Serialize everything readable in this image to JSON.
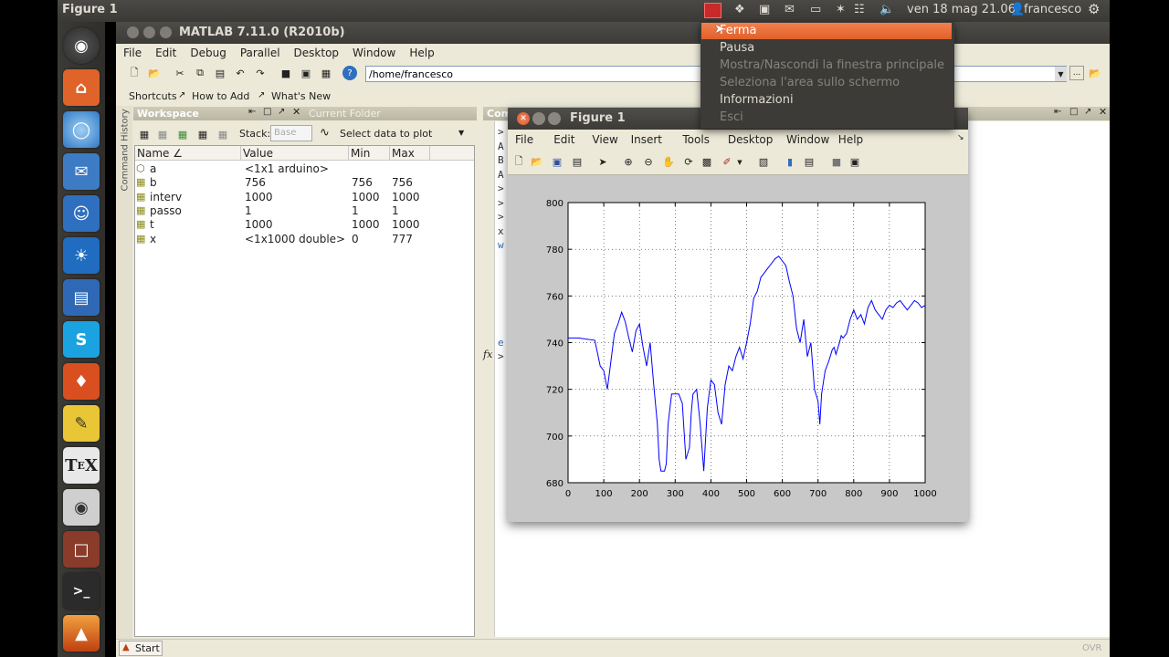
{
  "top_panel": {
    "app_title": "Figure 1",
    "clock": "ven 18 mag 21.06",
    "user": "francesco"
  },
  "matlab": {
    "title": "MATLAB  7.11.0 (R2010b)",
    "menu": [
      "File",
      "Edit",
      "Debug",
      "Parallel",
      "Desktop",
      "Window",
      "Help"
    ],
    "path": "/home/francesco",
    "shortcuts": [
      "Shortcuts",
      "How to Add",
      "What's New"
    ],
    "workspace_title": "Workspace",
    "current_folder_tab": "Current Folder",
    "command_window_tab": "Com",
    "command_history_label": "Command History",
    "stack_label": "Stack:",
    "stack_value": "Base",
    "select_plot": "Select data to plot",
    "columns": [
      "Name ∠",
      "Value",
      "Min",
      "Max"
    ],
    "variables": [
      {
        "name": "a",
        "value": "<1x1 arduino>",
        "min": "",
        "max": ""
      },
      {
        "name": "b",
        "value": "756",
        "min": "756",
        "max": "756"
      },
      {
        "name": "interv",
        "value": "1000",
        "min": "1000",
        "max": "1000"
      },
      {
        "name": "passo",
        "value": "1",
        "min": "1",
        "max": "1"
      },
      {
        "name": "t",
        "value": "1000",
        "min": "1000",
        "max": "1000"
      },
      {
        "name": "x",
        "value": "<1x1000 double>",
        "min": "0",
        "max": "777"
      }
    ],
    "cmd_lines": [
      ">",
      "A",
      "B",
      "A",
      ">",
      ">",
      ">",
      "x",
      "w"
    ],
    "cmd_lines2": [
      "e",
      ">"
    ],
    "fx": "fx",
    "start": "Start",
    "ovr": "OVR"
  },
  "figure": {
    "title": "Figure 1",
    "menu": [
      "File",
      "Edit",
      "View",
      "Insert",
      "Tools",
      "Desktop",
      "Window",
      "Help"
    ]
  },
  "dropdown": {
    "items": [
      {
        "label": "Ferma",
        "state": "highlighted"
      },
      {
        "label": "Pausa",
        "state": "enabled"
      },
      {
        "label": "Mostra/Nascondi la finestra principale",
        "state": "disabled"
      },
      {
        "label": "Seleziona l'area sullo schermo",
        "state": "disabled"
      },
      {
        "label": "Informazioni",
        "state": "enabled"
      },
      {
        "label": "Esci",
        "state": "disabled"
      }
    ]
  },
  "chart_data": {
    "type": "line",
    "title": "",
    "xlabel": "",
    "ylabel": "",
    "xlim": [
      0,
      1000
    ],
    "ylim": [
      680,
      800
    ],
    "grid": true,
    "x_ticks": [
      0,
      100,
      200,
      300,
      400,
      500,
      600,
      700,
      800,
      900,
      1000
    ],
    "y_ticks": [
      680,
      700,
      720,
      740,
      760,
      780,
      800
    ],
    "color": "#0000ff",
    "x": [
      0,
      30,
      75,
      90,
      100,
      110,
      120,
      130,
      140,
      150,
      160,
      170,
      180,
      190,
      200,
      210,
      220,
      230,
      240,
      250,
      255,
      260,
      270,
      275,
      280,
      290,
      300,
      310,
      320,
      330,
      340,
      345,
      350,
      360,
      370,
      380,
      390,
      400,
      410,
      420,
      430,
      440,
      445,
      450,
      460,
      470,
      480,
      490,
      500,
      510,
      520,
      530,
      540,
      550,
      560,
      570,
      580,
      590,
      600,
      610,
      620,
      630,
      640,
      650,
      660,
      670,
      680,
      690,
      700,
      705,
      710,
      720,
      730,
      740,
      745,
      750,
      760,
      765,
      770,
      780,
      790,
      800,
      810,
      820,
      830,
      840,
      850,
      860,
      870,
      880,
      890,
      900,
      910,
      920,
      930,
      940,
      950,
      960,
      970,
      980,
      990,
      1000
    ],
    "y": [
      742,
      742,
      741,
      730,
      728,
      720,
      732,
      744,
      748,
      753,
      749,
      742,
      736,
      745,
      748,
      738,
      730,
      740,
      722,
      705,
      690,
      685,
      685,
      688,
      705,
      718,
      718,
      718,
      714,
      690,
      695,
      710,
      718,
      720,
      705,
      685,
      712,
      724,
      722,
      710,
      705,
      722,
      726,
      730,
      728,
      734,
      738,
      733,
      740,
      748,
      759,
      762,
      768,
      770,
      772,
      774,
      776,
      777,
      775,
      773,
      766,
      760,
      746,
      740,
      750,
      734,
      740,
      720,
      715,
      705,
      718,
      728,
      732,
      737,
      738,
      735,
      740,
      743,
      742,
      744,
      750,
      754,
      750,
      752,
      748,
      755,
      758,
      754,
      752,
      750,
      754,
      756,
      755,
      757,
      758,
      756,
      754,
      756,
      758,
      757,
      755,
      756
    ]
  }
}
